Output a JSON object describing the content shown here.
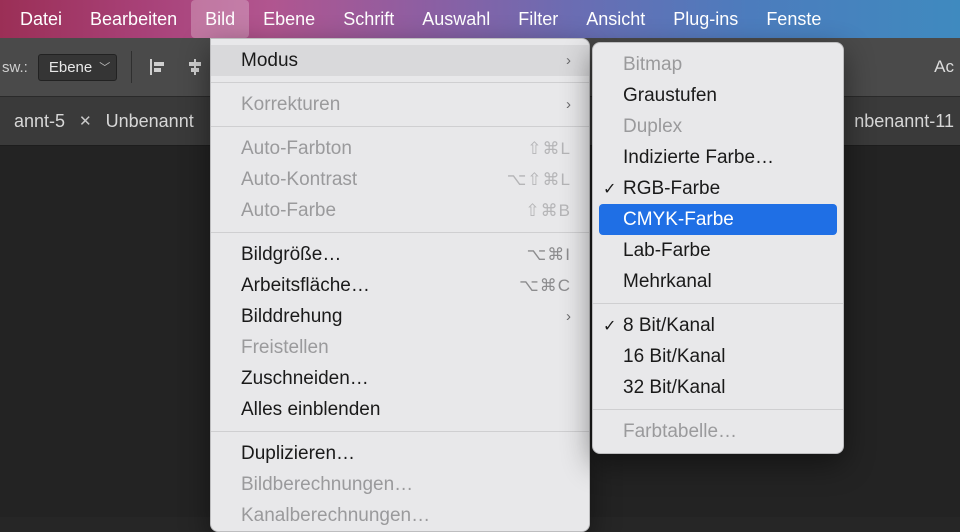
{
  "menubar": {
    "items": [
      "Datei",
      "Bearbeiten",
      "Bild",
      "Ebene",
      "Schrift",
      "Auswahl",
      "Filter",
      "Ansicht",
      "Plug-ins",
      "Fenste"
    ],
    "active_index": 2
  },
  "toolbar": {
    "sw_label": "sw.:",
    "select_value": "Ebene",
    "right_fragment": "Ac"
  },
  "tabs": {
    "left": "annt-5",
    "mid": "Unbenannt",
    "right": "nbenannt-11"
  },
  "menu_main": {
    "items": [
      {
        "label": "Modus",
        "type": "submenu",
        "hover": true
      },
      {
        "type": "sep"
      },
      {
        "label": "Korrekturen",
        "type": "submenu",
        "disabled": true
      },
      {
        "type": "sep"
      },
      {
        "label": "Auto-Farbton",
        "shortcut": "⇧⌘L",
        "disabled": true
      },
      {
        "label": "Auto-Kontrast",
        "shortcut": "⌥⇧⌘L",
        "disabled": true
      },
      {
        "label": "Auto-Farbe",
        "shortcut": "⇧⌘B",
        "disabled": true
      },
      {
        "type": "sep"
      },
      {
        "label": "Bildgröße…",
        "shortcut": "⌥⌘I"
      },
      {
        "label": "Arbeitsfläche…",
        "shortcut": "⌥⌘C"
      },
      {
        "label": "Bilddrehung",
        "type": "submenu"
      },
      {
        "label": "Freistellen",
        "disabled": true
      },
      {
        "label": "Zuschneiden…"
      },
      {
        "label": "Alles einblenden"
      },
      {
        "type": "sep"
      },
      {
        "label": "Duplizieren…"
      },
      {
        "label": "Bildberechnungen…",
        "disabled": true
      },
      {
        "label": "Kanalberechnungen…",
        "disabled": true
      }
    ]
  },
  "menu_sub": {
    "items": [
      {
        "label": "Bitmap",
        "disabled": true
      },
      {
        "label": "Graustufen"
      },
      {
        "label": "Duplex",
        "disabled": true
      },
      {
        "label": "Indizierte Farbe…"
      },
      {
        "label": "RGB-Farbe",
        "checked": true
      },
      {
        "label": "CMYK-Farbe",
        "highlight": true
      },
      {
        "label": "Lab-Farbe"
      },
      {
        "label": "Mehrkanal"
      },
      {
        "type": "sep"
      },
      {
        "label": "8 Bit/Kanal",
        "checked": true
      },
      {
        "label": "16 Bit/Kanal"
      },
      {
        "label": "32 Bit/Kanal"
      },
      {
        "type": "sep"
      },
      {
        "label": "Farbtabelle…",
        "disabled": true
      }
    ]
  }
}
